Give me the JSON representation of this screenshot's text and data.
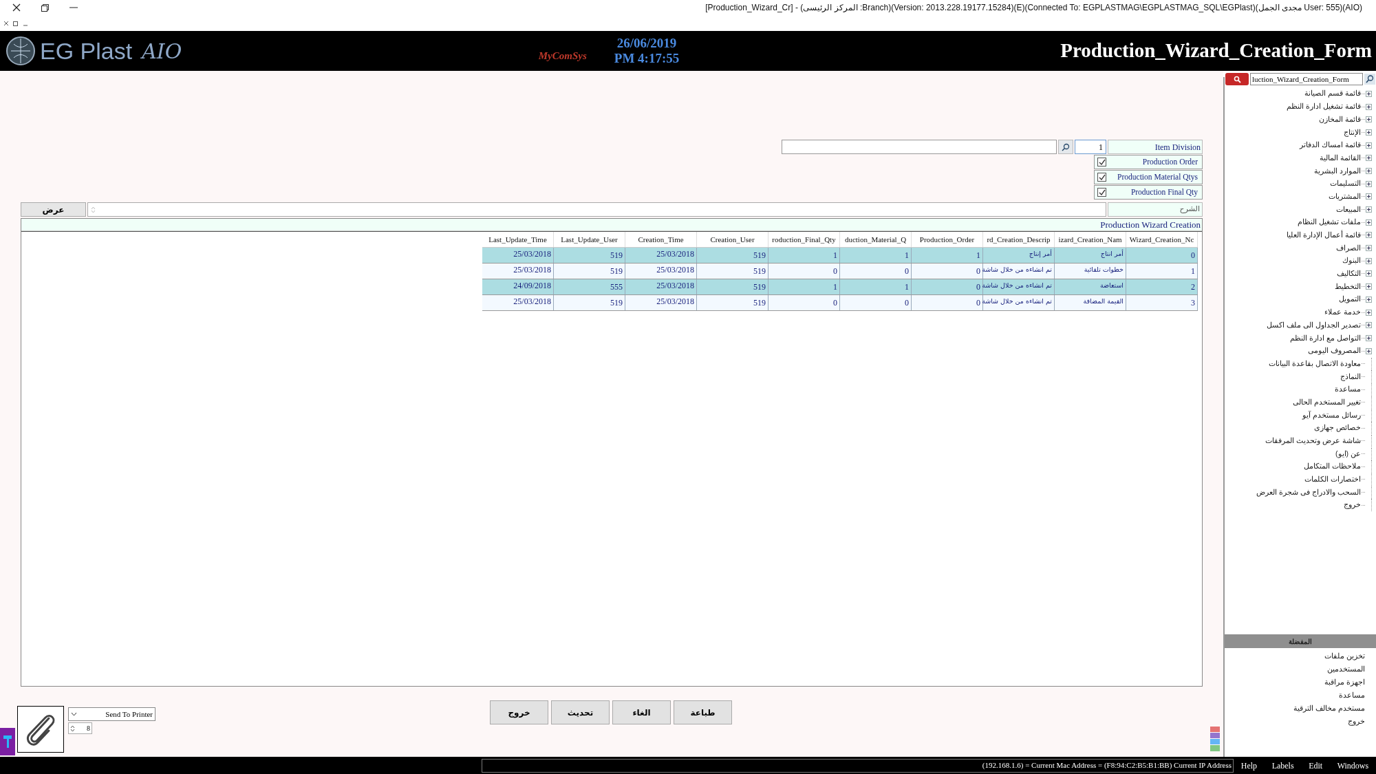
{
  "title_bar": {
    "text": "[Production_Wizard_Cr] - (المركز الرئيسى :Branch)(Version: 2013.228.19177.15284)(E)(Connected To: EGPLASTMAG\\EGPLASTMAG_SQL\\EGPlast)(مجدى الجمل User: 555)(AIO)"
  },
  "header": {
    "logo_text": "EG Plast",
    "logo_script": "AIO",
    "brand": "MyComSys",
    "date": "26/06/2019",
    "time": "PM 4:17:55",
    "form_title": "Production_Wizard_Creation_Form"
  },
  "form": {
    "item_division": {
      "label": "Item Division",
      "value": "1"
    },
    "checks": [
      {
        "label": "Production Order",
        "checked": true
      },
      {
        "label": "Production Material Qtys",
        "checked": true
      },
      {
        "label": "Production Final Qty",
        "checked": true
      }
    ],
    "description": {
      "label": "الشرح"
    },
    "show_button": "عرض",
    "section_title": "Production Wizard Creation"
  },
  "table": {
    "columns": [
      "Wizard_Creation_Nc",
      "izard_Creation_Nam",
      "rd_Creation_Descrip",
      "Production_Order",
      "duction_Material_Q",
      "roduction_Final_Qty",
      "Creation_User",
      "Creation_Time",
      "Last_Update_User",
      "Last_Update_Time"
    ],
    "rows": [
      [
        "0",
        "أمر انتاج",
        "أمر إنتاج",
        "1",
        "1",
        "1",
        "519",
        "25/03/2018",
        "519",
        "25/03/2018"
      ],
      [
        "1",
        "خطوات تلقائية",
        "تم انشاءه من خلال شاشة",
        "0",
        "0",
        "0",
        "519",
        "25/03/2018",
        "519",
        "25/03/2018"
      ],
      [
        "2",
        "استعاضة",
        "تم انشاءه من خلال شاشة",
        "0",
        "1",
        "1",
        "519",
        "25/03/2018",
        "555",
        "24/09/2018"
      ],
      [
        "3",
        "القيمة المضافة",
        "تم انشاءه من خلال شاشة",
        "0",
        "0",
        "0",
        "519",
        "25/03/2018",
        "519",
        "25/03/2018"
      ]
    ]
  },
  "bottom": {
    "printer": "Send To Printer",
    "copies": "8",
    "buttons": [
      "طباعة",
      "الغاء",
      "تحديث",
      "خروج"
    ]
  },
  "sidebar": {
    "search": "luction_Wizard_Creation_Form",
    "items": [
      {
        "label": "قائمة قسم الصيانة",
        "expandable": true
      },
      {
        "label": "قائمة تشغيل ادارة النظم",
        "expandable": true
      },
      {
        "label": "قائمة المخازن",
        "expandable": true
      },
      {
        "label": "الإنتاج",
        "expandable": true
      },
      {
        "label": "قائمة امساك الدفاتر",
        "expandable": true
      },
      {
        "label": "القائمة المالية",
        "expandable": true
      },
      {
        "label": "الموارد البشرية",
        "expandable": true
      },
      {
        "label": "التسليمات",
        "expandable": true
      },
      {
        "label": "المشتريات",
        "expandable": true
      },
      {
        "label": "المبيعات",
        "expandable": true
      },
      {
        "label": "ملفات تشغيل النظام",
        "expandable": true
      },
      {
        "label": "قائمة أعمال الإدارة العليا",
        "expandable": true
      },
      {
        "label": "الصراف",
        "expandable": true
      },
      {
        "label": "البنوك",
        "expandable": true
      },
      {
        "label": "التكاليف",
        "expandable": true
      },
      {
        "label": "التخطيط",
        "expandable": true
      },
      {
        "label": "التمويل",
        "expandable": true
      },
      {
        "label": "خدمة عملاء",
        "expandable": true
      },
      {
        "label": "تصدير الجداول الى ملف اكسل",
        "expandable": true
      },
      {
        "label": "التواصل مع ادارة النظم",
        "expandable": true
      },
      {
        "label": "المصروف اليومى",
        "expandable": true
      },
      {
        "label": "معاودة الاتصال بقاعدة البيانات",
        "expandable": false
      },
      {
        "label": "النماذج",
        "expandable": false
      },
      {
        "label": "مساعدة",
        "expandable": false
      },
      {
        "label": "تغيير المستخدم الحالى",
        "expandable": false
      },
      {
        "label": "رسائل مستخدم آيو",
        "expandable": false
      },
      {
        "label": "خصائص جهازى",
        "expandable": false
      },
      {
        "label": "شاشة عرض وتحديث المرفقات",
        "expandable": false
      },
      {
        "label": "عن (ايو)",
        "expandable": false
      },
      {
        "label": "ملاحظات المتكامل",
        "expandable": false
      },
      {
        "label": "اختصارات الكلمات",
        "expandable": false
      },
      {
        "label": "السحب والادراج فى شجرة العرض",
        "expandable": false
      },
      {
        "label": "خروج",
        "expandable": false
      }
    ],
    "favorites_title": "المفضلة",
    "favorites": [
      "تخزين ملفات",
      "المستخدمين",
      "اجهزة مراقبة",
      "مساعدة",
      "مستخدم مخالف الترقية",
      "خروج"
    ]
  },
  "status_bar": {
    "text": "(192.168.1.6) = Current Mac Address = (F8:94:C2:B5:B1:BB) Current IP Address",
    "menus": [
      "Windows",
      "Edit",
      "Labels",
      "Help"
    ]
  }
}
